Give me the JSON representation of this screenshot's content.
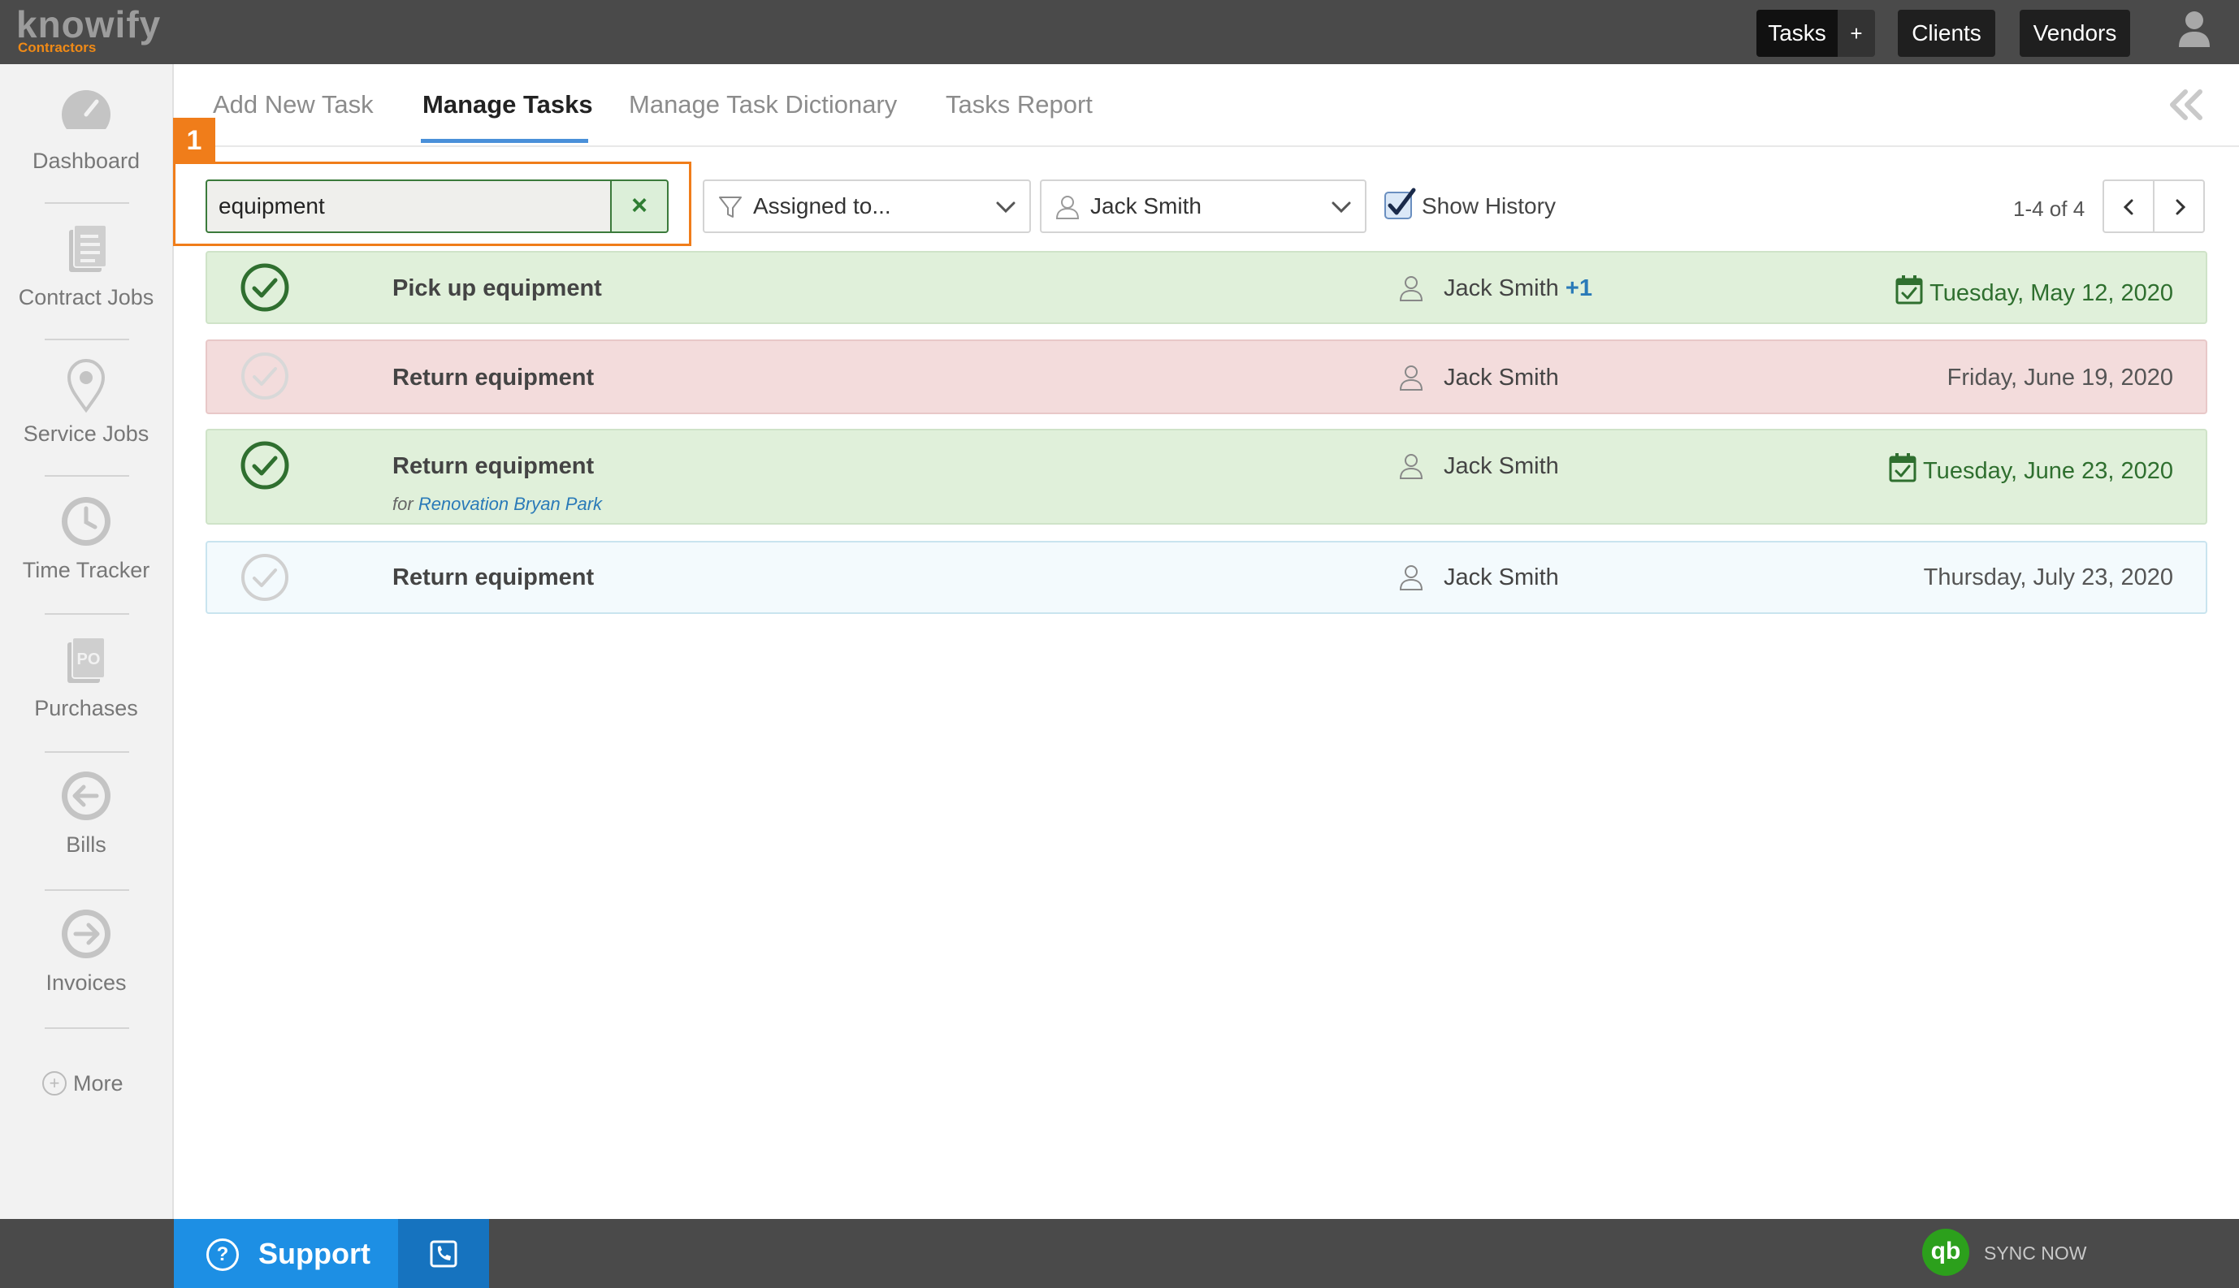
{
  "app": {
    "logo_text": "knowify",
    "logo_subtext": "Contractors"
  },
  "topnav": {
    "tasks_label": "Tasks",
    "tasks_add_label": "+",
    "clients_label": "Clients",
    "vendors_label": "Vendors",
    "user_icon": "user-icon"
  },
  "sidebar": {
    "items": [
      {
        "label": "Dashboard",
        "icon": "gauge-icon"
      },
      {
        "label": "Contract Jobs",
        "icon": "document-icon"
      },
      {
        "label": "Service Jobs",
        "icon": "map-pin-icon"
      },
      {
        "label": "Time Tracker",
        "icon": "clock-icon"
      },
      {
        "label": "Purchases",
        "icon": "po-icon"
      },
      {
        "label": "Bills",
        "icon": "arrow-left-circle-icon"
      },
      {
        "label": "Invoices",
        "icon": "arrow-right-circle-icon"
      }
    ],
    "more_label": "More"
  },
  "tabs": [
    {
      "label": "Add New Task",
      "active": false
    },
    {
      "label": "Manage Tasks",
      "active": true
    },
    {
      "label": "Manage Task Dictionary",
      "active": false
    },
    {
      "label": "Tasks Report",
      "active": false
    }
  ],
  "annotation": {
    "number": "1",
    "color": "#f07d1a"
  },
  "filters": {
    "search_value": "equipment",
    "search_clear": "×",
    "assigned_placeholder": "Assigned to...",
    "user_value": "Jack Smith",
    "show_history_label": "Show History",
    "show_history_checked": true
  },
  "pagination": {
    "label": "1-4 of 4"
  },
  "tasks": [
    {
      "name": "Pick up equipment",
      "user": "Jack Smith",
      "extra": "+1",
      "date": "Tuesday, May 12, 2020",
      "completed": true,
      "status": "green"
    },
    {
      "name": "Return equipment",
      "user": "Jack Smith",
      "extra": "",
      "date": "Friday, June 19, 2020",
      "completed": false,
      "status": "red"
    },
    {
      "name": "Return equipment",
      "user": "Jack Smith",
      "extra": "",
      "date": "Tuesday, June 23, 2020",
      "completed": true,
      "status": "green",
      "for_prefix": "for",
      "for_link": "Renovation Bryan Park"
    },
    {
      "name": "Return equipment",
      "user": "Jack Smith",
      "extra": "",
      "date": "Thursday, July 23, 2020",
      "completed": false,
      "status": "blue"
    }
  ],
  "footer": {
    "support_label": "Support",
    "qb_logo": "qb",
    "sync_label": "SYNC NOW"
  },
  "colors": {
    "accent_blue": "#1d8fe4",
    "done_green": "#2f6f2f",
    "overdue_red": "#f3dcdc",
    "highlight_orange": "#f07d1a"
  }
}
